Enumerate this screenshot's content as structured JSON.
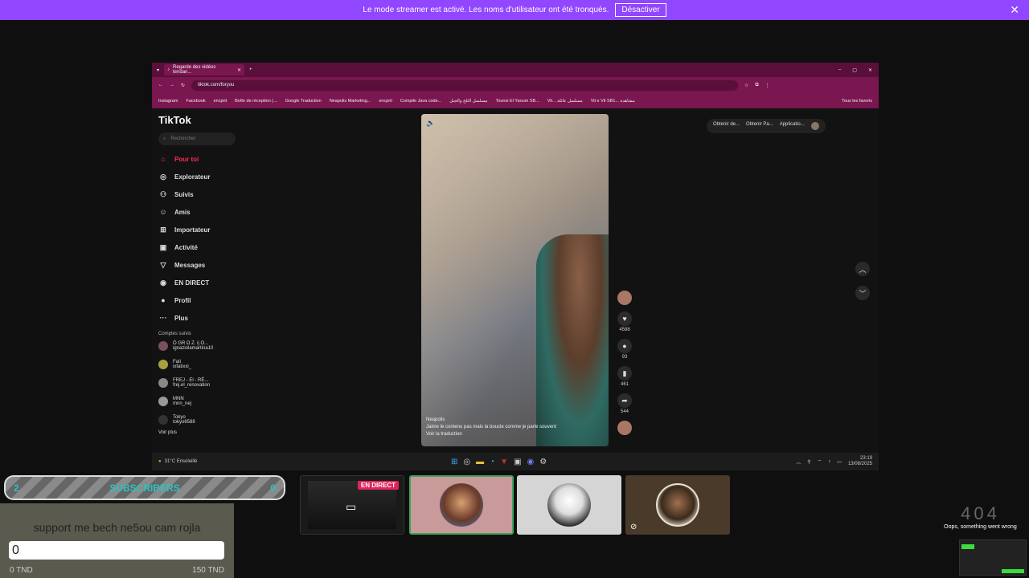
{
  "banner": {
    "text": "Le mode streamer est activé. Les noms d'utilisateur ont été tronqués.",
    "button": "Désactiver"
  },
  "browser": {
    "tab_title": "Regarde des vidéos tendan...",
    "url": "tiktok.com/foryou",
    "bookmarks": [
      "Instagram",
      "Facebook",
      "encprit",
      "Boîte de réception (...",
      "Google Traduction",
      "Neapolis Marketing...",
      "encprit",
      "Compile Java code...",
      "مسلسل الثلج والجبل",
      "Tounsi El Yaoum SB...",
      "Vit... مسلسل عائلة",
      "Vit e Vit SB1... مشاهدة",
      "Tous les favoris"
    ]
  },
  "tiktok": {
    "logo": "TikTok",
    "search_placeholder": "Rechercher",
    "nav": [
      "Pour toi",
      "Explorateur",
      "Suivis",
      "Amis",
      "Importateur",
      "Activité",
      "Messages",
      "EN DIRECT",
      "Profil",
      "Plus"
    ],
    "following_title": "Comptes suivis",
    "following": [
      {
        "name": "Ö GR Ω Z. ij O...",
        "handle": "ignaziolamartina10"
      },
      {
        "name": "Fati",
        "handle": "ixfatixxi_"
      },
      {
        "name": "FREJ - El - RÉ...",
        "handle": "frej.el_renovation"
      },
      {
        "name": "MNN",
        "handle": "mnn_nej"
      },
      {
        "name": "Tokyo",
        "handle": "tokyo6588"
      }
    ],
    "see_more": "Voir plus",
    "top_actions": [
      "Obtenir de...",
      "Obtenir Pa...",
      "Applicatio..."
    ],
    "video": {
      "author": "Neapolis",
      "caption": "Jaime le contenu pas mais la boucle comme je parle souvent",
      "translate": "Voir la traduction"
    },
    "counts": {
      "likes": "4588",
      "comments": "93",
      "saves": "461",
      "shares": "544"
    },
    "taskbar": {
      "weather": "31°C",
      "weather_sub": "Ensoleillé",
      "time": "23:19",
      "date": "13/08/2025"
    }
  },
  "overlay": {
    "subs_left": "2",
    "subs_label": "SUBSCRIBERS",
    "subs_right": "0",
    "goal_title": "support me bech ne5ou cam rojla",
    "goal_value": "0",
    "goal_min": "0 TND",
    "goal_max": "150 TND",
    "live_label": "EN DIRECT",
    "error_code": "404",
    "error_msg": "Oops, something went wrong"
  }
}
